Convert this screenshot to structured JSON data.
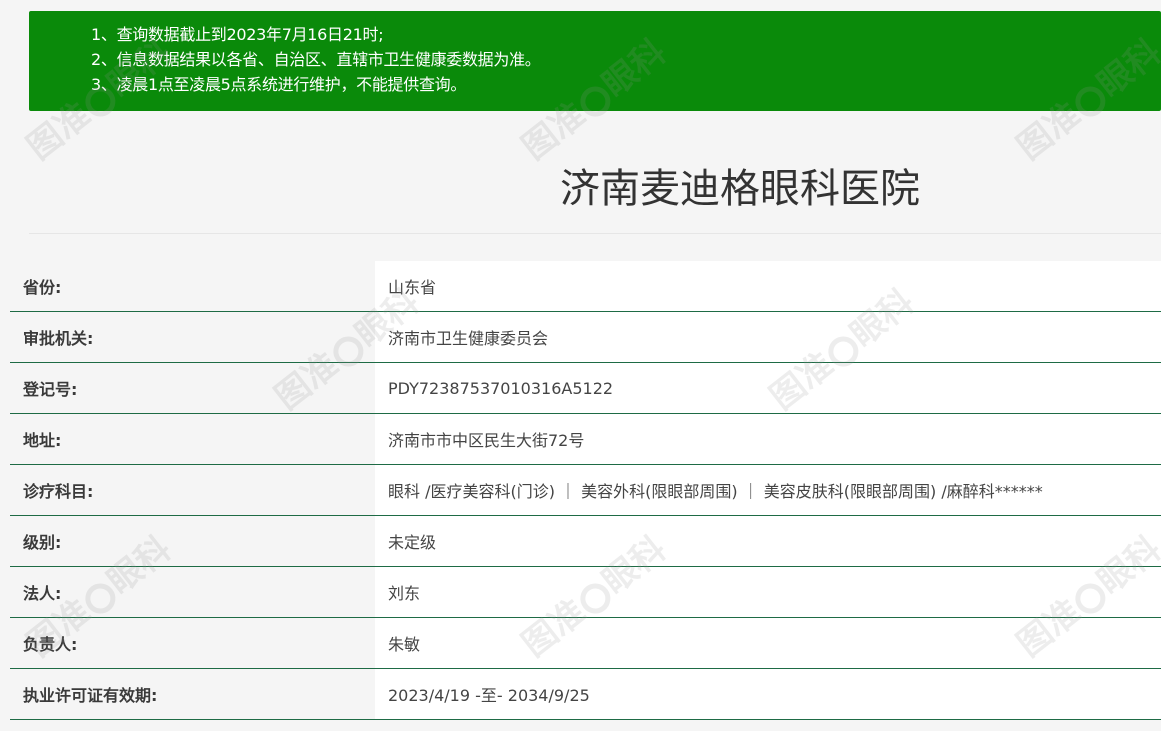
{
  "notice": {
    "lines": [
      "1、查询数据截止到2023年7月16日21时;",
      "2、信息数据结果以各省、自治区、直辖市卫生健康委数据为准。",
      "3、凌晨1点至凌晨5点系统进行维护，不能提供查询。"
    ],
    "background_color": "#0a8a0a"
  },
  "hospital": {
    "name": "济南麦迪格眼科医院"
  },
  "info": {
    "rows": [
      {
        "label": "省份:",
        "value": "山东省"
      },
      {
        "label": "审批机关:",
        "value": "济南市卫生健康委员会"
      },
      {
        "label": "登记号:",
        "value": "PDY72387537010316A5122"
      },
      {
        "label": "地址:",
        "value": "济南市市中区民生大街72号"
      },
      {
        "label": "诊疗科目:",
        "value": "眼科 /医疗美容科(门诊) ｜ 美容外科(限眼部周围) ｜ 美容皮肤科(限眼部周围) /麻醉科******"
      },
      {
        "label": "级别:",
        "value": "未定级"
      },
      {
        "label": "法人:",
        "value": "刘东"
      },
      {
        "label": "负责人:",
        "value": "朱敏"
      },
      {
        "label": "执业许可证有效期:",
        "value": "2023/4/19 -至- 2034/9/25"
      }
    ],
    "divider_color": "#1e6b45"
  },
  "watermark": {
    "text_before": "图准",
    "text_after": "眼科"
  }
}
